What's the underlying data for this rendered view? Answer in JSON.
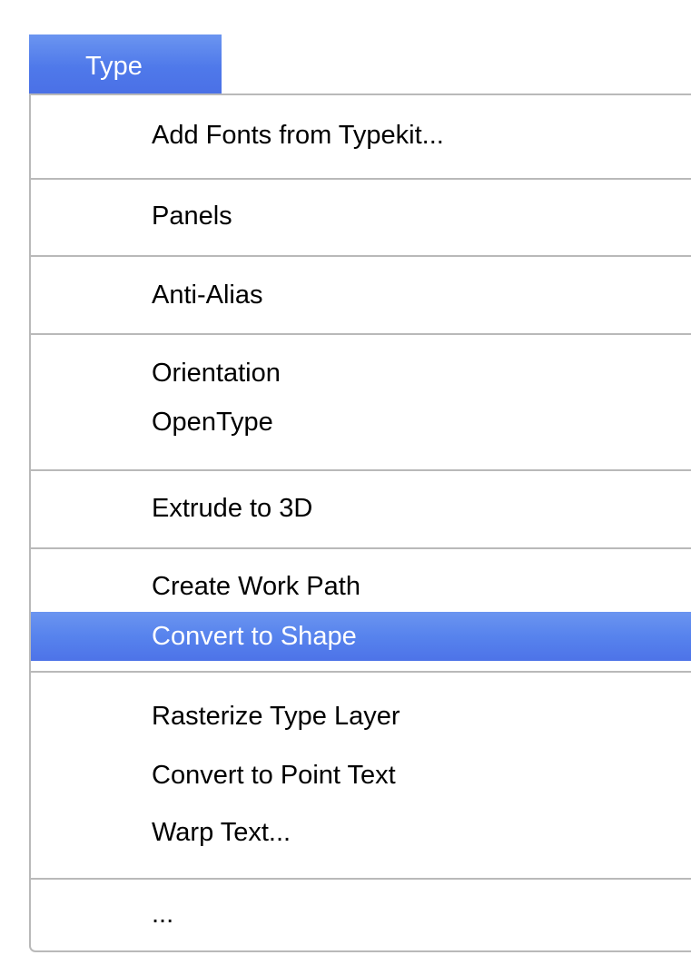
{
  "menu": {
    "title": "Type",
    "accent_color": "#4f79ea",
    "selected_text_color": "#ffffff",
    "items": [
      {
        "label": "Add Fonts from Typekit..."
      },
      {
        "label": "Panels"
      },
      {
        "label": "Anti-Alias"
      },
      {
        "label": "Orientation"
      },
      {
        "label": "OpenType"
      },
      {
        "label": "Extrude to 3D"
      },
      {
        "label": "Create Work Path"
      },
      {
        "label": "Convert to Shape",
        "selected": true
      },
      {
        "label": "Rasterize Type Layer"
      },
      {
        "label": "Convert to Point Text"
      },
      {
        "label": "Warp Text..."
      },
      {
        "label": "..."
      }
    ]
  }
}
